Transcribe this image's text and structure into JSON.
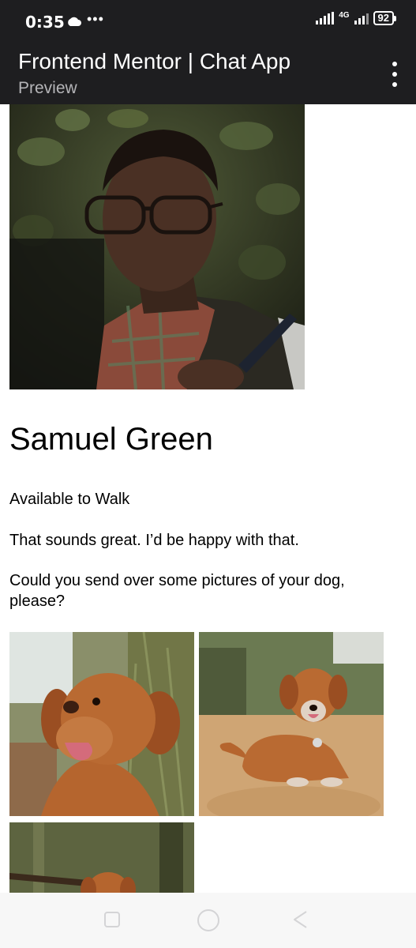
{
  "status_bar": {
    "time": "0:35",
    "dots": "•••",
    "network": "4G",
    "battery": "92",
    "icons": [
      "cloud-icon",
      "signal-icon",
      "signal-4g-icon",
      "battery-icon"
    ]
  },
  "app_header": {
    "title": "Frontend Mentor | Chat App",
    "subtitle": "Preview",
    "menu_icon": "kebab-menu-icon"
  },
  "profile": {
    "name": "Samuel Green",
    "photo_description": "man-with-glasses-and-scarf"
  },
  "messages": [
    "Available to Walk",
    "That sounds great. I’d be happy with that.",
    "Could you send over some pictures of your dog, please?"
  ],
  "dog_photos": [
    "dog-photo-closeup",
    "dog-photo-lying-on-sand",
    "dog-photo-with-stick"
  ],
  "nav_bar": {
    "icons": [
      "recent-apps-icon",
      "home-icon",
      "back-icon"
    ]
  },
  "colors": {
    "header_bg": "#1e1e20",
    "page_bg": "#ffffff",
    "subtitle": "#b5b5b8"
  }
}
